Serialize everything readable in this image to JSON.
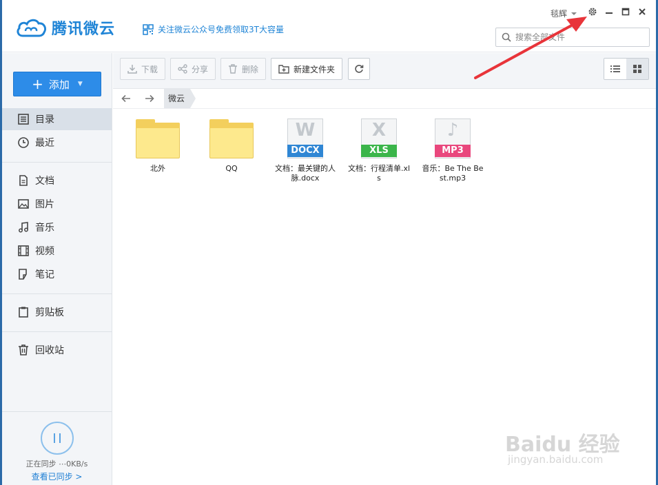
{
  "app": {
    "logo_text": "腾讯微云",
    "promo_text": "关注微云公众号免费领取3T大容量",
    "user_name": "毯辉"
  },
  "search": {
    "placeholder": "搜索全部文件"
  },
  "sidebar": {
    "add_label": "添加",
    "items": [
      {
        "label": "目录",
        "icon": "list-icon"
      },
      {
        "label": "最近",
        "icon": "clock-icon"
      },
      {
        "label": "文档",
        "icon": "document-icon"
      },
      {
        "label": "图片",
        "icon": "image-icon"
      },
      {
        "label": "音乐",
        "icon": "music-icon"
      },
      {
        "label": "视频",
        "icon": "film-icon"
      },
      {
        "label": "笔记",
        "icon": "note-icon"
      },
      {
        "label": "剪贴板",
        "icon": "clipboard-icon"
      },
      {
        "label": "回收站",
        "icon": "trash-icon"
      }
    ],
    "sync_status": "正在同步 ⋯0KB/s",
    "sync_link": "查看已同步 >"
  },
  "toolbar": {
    "download": "下载",
    "share": "分享",
    "delete": "删除",
    "new_folder": "新建文件夹"
  },
  "path": {
    "crumb": "微云"
  },
  "files": [
    {
      "name": "北外",
      "type": "folder"
    },
    {
      "name": "QQ",
      "type": "folder"
    },
    {
      "name": "文档：最关键的人脉.docx",
      "type": "docx",
      "letter": "W",
      "badge": "DOCX",
      "color": "#2f86d4"
    },
    {
      "name": "文档：行程清单.xls",
      "type": "xls",
      "letter": "X",
      "badge": "XLS",
      "color": "#3bb54a"
    },
    {
      "name": "音乐：Be The Best.mp3",
      "type": "mp3",
      "letter": "♪",
      "badge": "MP3",
      "color": "#e9477d"
    }
  ],
  "watermark": {
    "main": "Baidu 经验",
    "sub": "jingyan.baidu.com"
  },
  "colors": {
    "accent": "#2d8ce8",
    "brand": "#1f84d6",
    "annotation_arrow": "#e8343a"
  }
}
